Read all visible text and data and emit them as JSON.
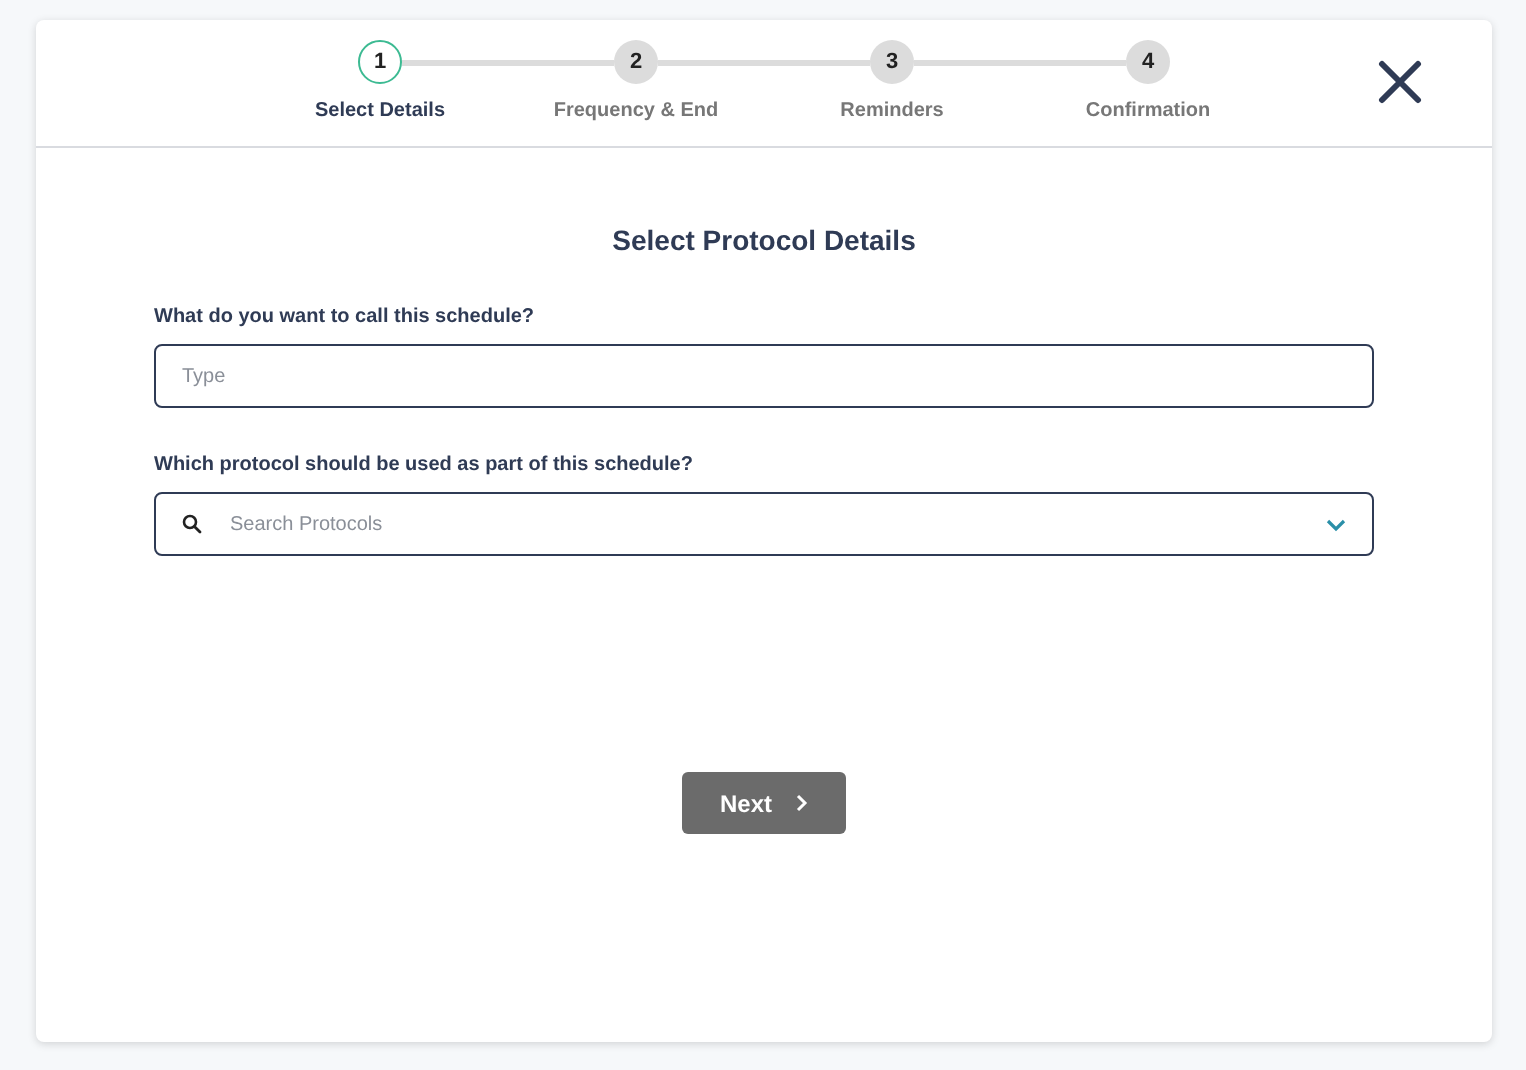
{
  "steps": [
    {
      "number": "1",
      "label": "Select Details",
      "selected": true
    },
    {
      "number": "2",
      "label": "Frequency & End",
      "selected": false
    },
    {
      "number": "3",
      "label": "Reminders",
      "selected": false
    },
    {
      "number": "4",
      "label": "Confirmation",
      "selected": false
    }
  ],
  "title": "Select Protocol Details",
  "fields": [
    {
      "kind": "text",
      "label": "What do you want to call this schedule?",
      "placeholder": "Type"
    },
    {
      "kind": "search-select",
      "label": "Which protocol should be used as part of this schedule?",
      "placeholder": "Search Protocols"
    }
  ],
  "next_button": {
    "label": "Next",
    "disabled": true
  }
}
